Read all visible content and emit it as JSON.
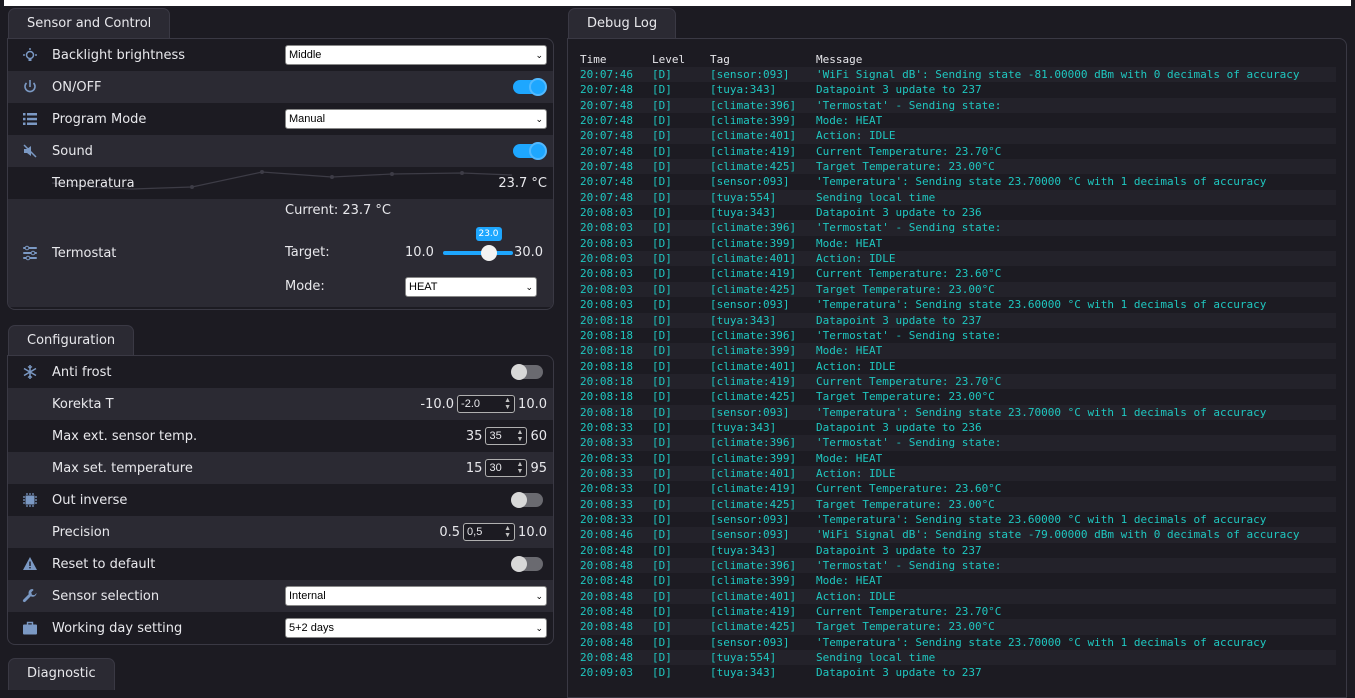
{
  "sensor_card": {
    "title": "Sensor and Control",
    "backlight": {
      "label": "Backlight brightness",
      "value": "Middle"
    },
    "onoff": {
      "label": "ON/OFF",
      "state": true
    },
    "program_mode": {
      "label": "Program Mode",
      "value": "Manual"
    },
    "sound": {
      "label": "Sound",
      "state": true
    },
    "temperatura": {
      "label": "Temperatura",
      "value": "23.7 °C"
    },
    "termostat": {
      "label": "Termostat",
      "current": "Current: 23.7 °C",
      "target_label": "Target:",
      "min": "10.0",
      "max": "30.0",
      "target_value": "23.0",
      "slider_fraction": 0.65,
      "mode_label": "Mode:",
      "mode_value": "HEAT"
    }
  },
  "config_card": {
    "title": "Configuration",
    "anti_frost": {
      "label": "Anti frost",
      "state": false
    },
    "korekta": {
      "label": "Korekta T",
      "min": "-10.0",
      "value": "-2.0",
      "max": "10.0"
    },
    "max_ext": {
      "label": "Max ext. sensor temp.",
      "min": "35",
      "value": "35",
      "max": "60"
    },
    "max_set": {
      "label": "Max set. temperature",
      "min": "15",
      "value": "30",
      "max": "95"
    },
    "out_inverse": {
      "label": "Out inverse",
      "state": false
    },
    "precision": {
      "label": "Precision",
      "min": "0.5",
      "value": "0,5",
      "max": "10.0"
    },
    "reset": {
      "label": "Reset to default",
      "state": false
    },
    "sensor_sel": {
      "label": "Sensor selection",
      "value": "Internal"
    },
    "working_day": {
      "label": "Working day setting",
      "value": "5+2 days"
    }
  },
  "diagnostic_card": {
    "title": "Diagnostic"
  },
  "debug_log": {
    "title": "Debug Log",
    "headers": [
      "Time",
      "Level",
      "Tag",
      "Message"
    ],
    "rows": [
      [
        "20:07:46",
        "[D]",
        "[sensor:093]",
        "'WiFi Signal dB': Sending state -81.00000 dBm with 0 decimals of accuracy"
      ],
      [
        "20:07:48",
        "[D]",
        "[tuya:343]",
        "Datapoint 3 update to 237"
      ],
      [
        "20:07:48",
        "[D]",
        "[climate:396]",
        "'Termostat' - Sending state:"
      ],
      [
        "20:07:48",
        "[D]",
        "[climate:399]",
        "Mode: HEAT"
      ],
      [
        "20:07:48",
        "[D]",
        "[climate:401]",
        "Action: IDLE"
      ],
      [
        "20:07:48",
        "[D]",
        "[climate:419]",
        "Current Temperature: 23.70°C"
      ],
      [
        "20:07:48",
        "[D]",
        "[climate:425]",
        "Target Temperature: 23.00°C"
      ],
      [
        "20:07:48",
        "[D]",
        "[sensor:093]",
        "'Temperatura': Sending state 23.70000 °C with 1 decimals of accuracy"
      ],
      [
        "20:07:48",
        "[D]",
        "[tuya:554]",
        "Sending local time"
      ],
      [
        "20:08:03",
        "[D]",
        "[tuya:343]",
        "Datapoint 3 update to 236"
      ],
      [
        "20:08:03",
        "[D]",
        "[climate:396]",
        "'Termostat' - Sending state:"
      ],
      [
        "20:08:03",
        "[D]",
        "[climate:399]",
        "Mode: HEAT"
      ],
      [
        "20:08:03",
        "[D]",
        "[climate:401]",
        "Action: IDLE"
      ],
      [
        "20:08:03",
        "[D]",
        "[climate:419]",
        "Current Temperature: 23.60°C"
      ],
      [
        "20:08:03",
        "[D]",
        "[climate:425]",
        "Target Temperature: 23.00°C"
      ],
      [
        "20:08:03",
        "[D]",
        "[sensor:093]",
        "'Temperatura': Sending state 23.60000 °C with 1 decimals of accuracy"
      ],
      [
        "20:08:18",
        "[D]",
        "[tuya:343]",
        "Datapoint 3 update to 237"
      ],
      [
        "20:08:18",
        "[D]",
        "[climate:396]",
        "'Termostat' - Sending state:"
      ],
      [
        "20:08:18",
        "[D]",
        "[climate:399]",
        "Mode: HEAT"
      ],
      [
        "20:08:18",
        "[D]",
        "[climate:401]",
        "Action: IDLE"
      ],
      [
        "20:08:18",
        "[D]",
        "[climate:419]",
        "Current Temperature: 23.70°C"
      ],
      [
        "20:08:18",
        "[D]",
        "[climate:425]",
        "Target Temperature: 23.00°C"
      ],
      [
        "20:08:18",
        "[D]",
        "[sensor:093]",
        "'Temperatura': Sending state 23.70000 °C with 1 decimals of accuracy"
      ],
      [
        "20:08:33",
        "[D]",
        "[tuya:343]",
        "Datapoint 3 update to 236"
      ],
      [
        "20:08:33",
        "[D]",
        "[climate:396]",
        "'Termostat' - Sending state:"
      ],
      [
        "20:08:33",
        "[D]",
        "[climate:399]",
        "Mode: HEAT"
      ],
      [
        "20:08:33",
        "[D]",
        "[climate:401]",
        "Action: IDLE"
      ],
      [
        "20:08:33",
        "[D]",
        "[climate:419]",
        "Current Temperature: 23.60°C"
      ],
      [
        "20:08:33",
        "[D]",
        "[climate:425]",
        "Target Temperature: 23.00°C"
      ],
      [
        "20:08:33",
        "[D]",
        "[sensor:093]",
        "'Temperatura': Sending state 23.60000 °C with 1 decimals of accuracy"
      ],
      [
        "20:08:46",
        "[D]",
        "[sensor:093]",
        "'WiFi Signal dB': Sending state -79.00000 dBm with 0 decimals of accuracy"
      ],
      [
        "20:08:48",
        "[D]",
        "[tuya:343]",
        "Datapoint 3 update to 237"
      ],
      [
        "20:08:48",
        "[D]",
        "[climate:396]",
        "'Termostat' - Sending state:"
      ],
      [
        "20:08:48",
        "[D]",
        "[climate:399]",
        "Mode: HEAT"
      ],
      [
        "20:08:48",
        "[D]",
        "[climate:401]",
        "Action: IDLE"
      ],
      [
        "20:08:48",
        "[D]",
        "[climate:419]",
        "Current Temperature: 23.70°C"
      ],
      [
        "20:08:48",
        "[D]",
        "[climate:425]",
        "Target Temperature: 23.00°C"
      ],
      [
        "20:08:48",
        "[D]",
        "[sensor:093]",
        "'Temperatura': Sending state 23.70000 °C with 1 decimals of accuracy"
      ],
      [
        "20:08:48",
        "[D]",
        "[tuya:554]",
        "Sending local time"
      ],
      [
        "20:09:03",
        "[D]",
        "[tuya:343]",
        "Datapoint 3 update to 237"
      ]
    ]
  }
}
